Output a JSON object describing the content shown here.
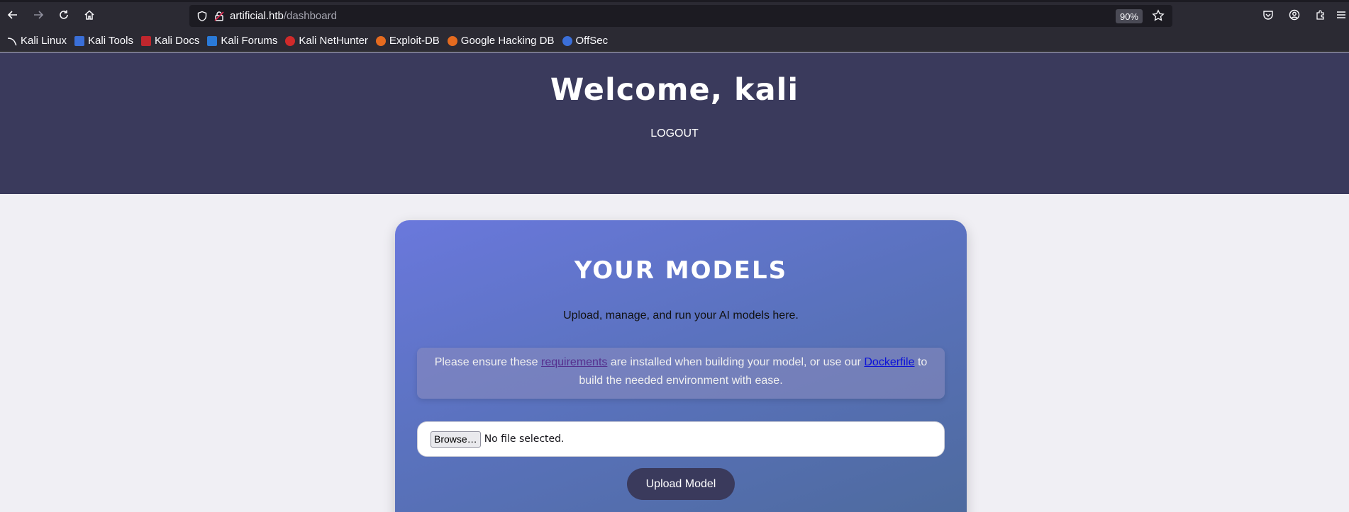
{
  "browser": {
    "url_host": "artificial.htb",
    "url_path": "/dashboard",
    "zoom": "90%"
  },
  "bookmarks": [
    {
      "label": "Kali Linux",
      "color": "#2b2a33"
    },
    {
      "label": "Kali Tools",
      "color": "#3a6fd8"
    },
    {
      "label": "Kali Docs",
      "color": "#c0262d"
    },
    {
      "label": "Kali Forums",
      "color": "#2a7ad8"
    },
    {
      "label": "Kali NetHunter",
      "color": "#d02a2a"
    },
    {
      "label": "Exploit-DB",
      "color": "#e56b1f"
    },
    {
      "label": "Google Hacking DB",
      "color": "#e56b1f"
    },
    {
      "label": "OffSec",
      "color": "#3b6fd9"
    }
  ],
  "header": {
    "title": "Welcome, kali",
    "logout_label": "LOGOUT"
  },
  "card": {
    "title": "YOUR MODELS",
    "subtitle": "Upload, manage, and run your AI models here.",
    "notice_before": "Please ensure these ",
    "notice_link1": "requirements",
    "notice_middle": " are installed when building your model, or use our ",
    "notice_link2": "Dockerfile",
    "notice_after": " to build the needed environment with ease.",
    "browse_label": "Browse…",
    "file_status": "No file selected.",
    "upload_label": "Upload Model"
  },
  "colors": {
    "header_bg": "#3a3a5c",
    "card_gradient_start": "#6a78dc",
    "card_gradient_end": "#4d6a9c",
    "button_bg": "#3a3a5c"
  }
}
